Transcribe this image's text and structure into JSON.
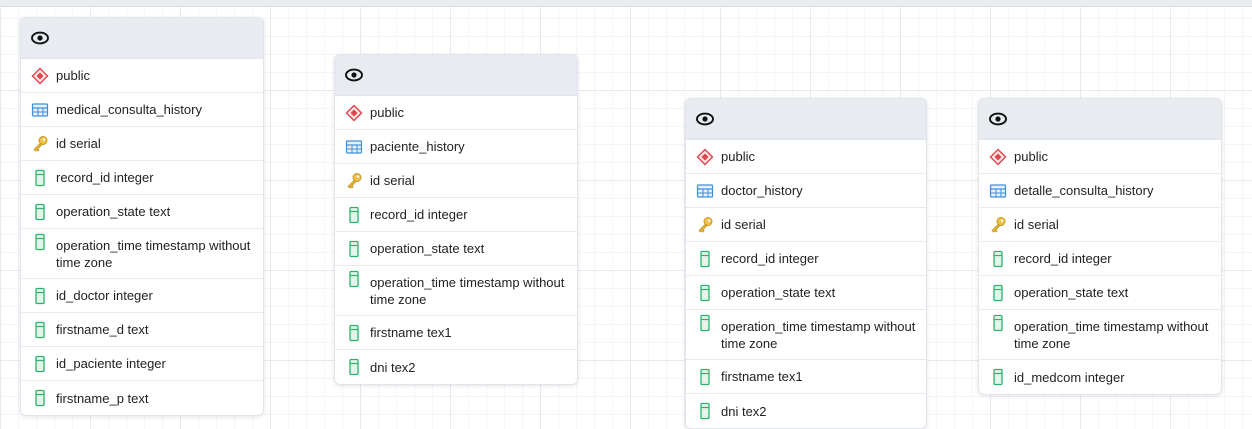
{
  "colors": {
    "schema_icon": "#e0444a",
    "table_icon": "#3f8fd8",
    "key_icon": "#e0b43a",
    "column_icon": "#2bb36a",
    "header_bg": "#e8ebf0"
  },
  "icons": {
    "header": "eye-icon",
    "schema": "schema-diamond-icon",
    "table": "table-grid-icon",
    "primary_key": "key-icon",
    "column": "column-icon"
  },
  "tables": [
    {
      "schema": "public",
      "name": "medical_consulta_history",
      "columns": [
        {
          "kind": "key",
          "text": "id serial"
        },
        {
          "kind": "column",
          "text": "record_id integer"
        },
        {
          "kind": "column",
          "text": "operation_state text"
        },
        {
          "kind": "column",
          "text": "operation_time timestamp without time zone"
        },
        {
          "kind": "column",
          "text": "id_doctor integer"
        },
        {
          "kind": "column",
          "text": "firstname_d text"
        },
        {
          "kind": "column",
          "text": "id_paciente integer"
        },
        {
          "kind": "column",
          "text": "firstname_p text"
        }
      ]
    },
    {
      "schema": "public",
      "name": "paciente_history",
      "columns": [
        {
          "kind": "key",
          "text": "id serial"
        },
        {
          "kind": "column",
          "text": "record_id integer"
        },
        {
          "kind": "column",
          "text": "operation_state text"
        },
        {
          "kind": "column",
          "text": "operation_time timestamp without time zone"
        },
        {
          "kind": "column",
          "text": "firstname tex1"
        },
        {
          "kind": "column",
          "text": "dni tex2"
        }
      ]
    },
    {
      "schema": "public",
      "name": "doctor_history",
      "columns": [
        {
          "kind": "key",
          "text": "id serial"
        },
        {
          "kind": "column",
          "text": "record_id integer"
        },
        {
          "kind": "column",
          "text": "operation_state text"
        },
        {
          "kind": "column",
          "text": "operation_time timestamp without time zone"
        },
        {
          "kind": "column",
          "text": "firstname tex1"
        },
        {
          "kind": "column",
          "text": "dni tex2"
        }
      ]
    },
    {
      "schema": "public",
      "name": "detalle_consulta_history",
      "columns": [
        {
          "kind": "key",
          "text": "id serial"
        },
        {
          "kind": "column",
          "text": "record_id integer"
        },
        {
          "kind": "column",
          "text": "operation_state text"
        },
        {
          "kind": "column",
          "text": "operation_time timestamp without time zone"
        },
        {
          "kind": "column",
          "text": "id_medcom integer"
        }
      ]
    }
  ]
}
